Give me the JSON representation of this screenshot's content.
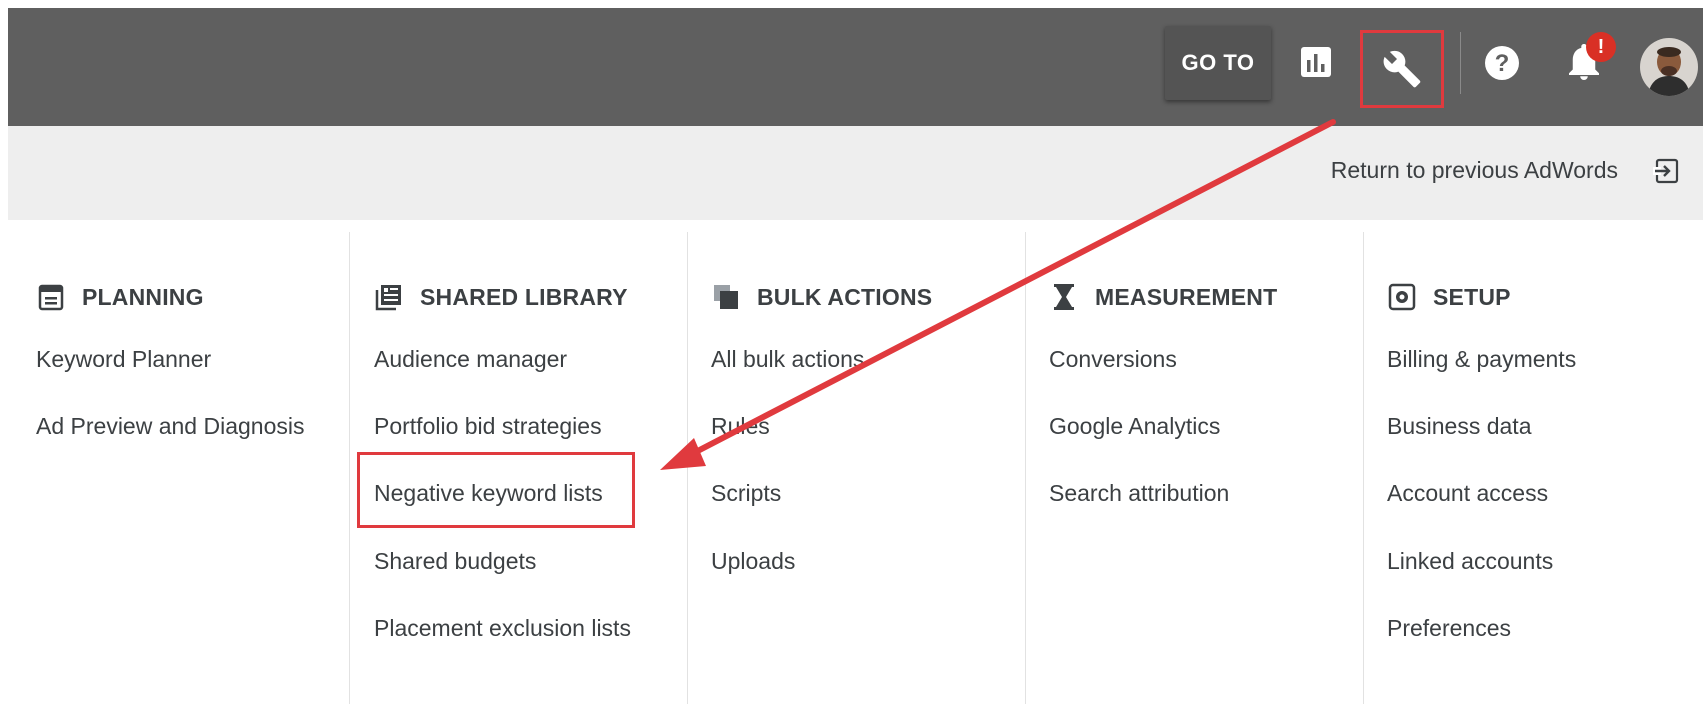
{
  "topbar": {
    "goto_label": "GO TO",
    "notification_badge": "!",
    "icons": [
      "reports-chart-icon",
      "wrench-tools-icon",
      "help-icon",
      "bell-icon",
      "avatar"
    ]
  },
  "subbar": {
    "return_label": "Return to previous AdWords"
  },
  "columns": [
    {
      "heading": "PLANNING",
      "icon": "calendar-note-icon",
      "items": [
        "Keyword Planner",
        "Ad Preview and Diagnosis"
      ]
    },
    {
      "heading": "SHARED LIBRARY",
      "icon": "library-grid-icon",
      "items": [
        "Audience manager",
        "Portfolio bid strategies",
        "Negative keyword lists",
        "Shared budgets",
        "Placement exclusion lists"
      ]
    },
    {
      "heading": "BULK ACTIONS",
      "icon": "copy-stack-icon",
      "items": [
        "All bulk actions",
        "Rules",
        "Scripts",
        "Uploads"
      ]
    },
    {
      "heading": "MEASUREMENT",
      "icon": "hourglass-icon",
      "items": [
        "Conversions",
        "Google Analytics",
        "Search attribution"
      ]
    },
    {
      "heading": "SETUP",
      "icon": "settings-box-icon",
      "items": [
        "Billing & payments",
        "Business data",
        "Account access",
        "Linked accounts",
        "Preferences"
      ]
    }
  ],
  "annotation": {
    "color": "#e03a3e",
    "highlighted_tool": "wrench-tools-icon",
    "highlighted_item": "Negative keyword lists"
  }
}
